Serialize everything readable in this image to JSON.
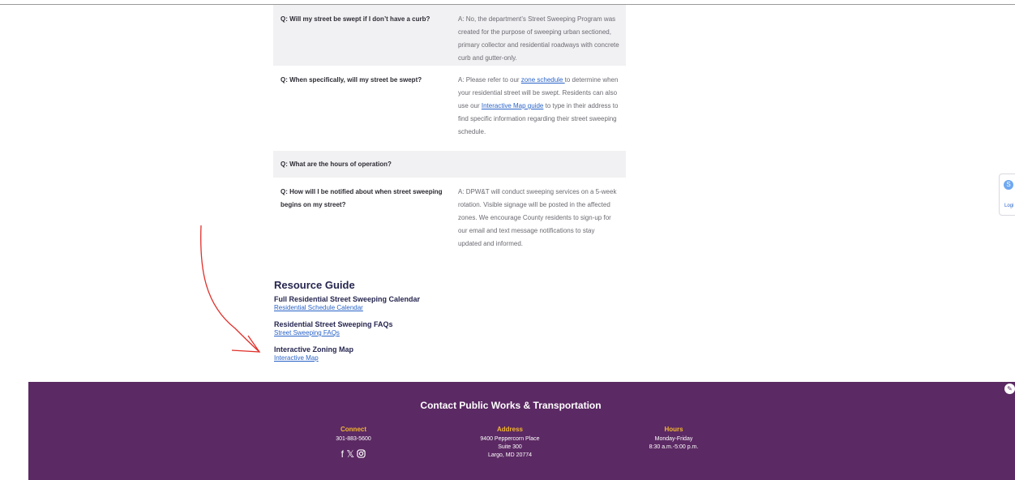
{
  "faq": [
    {
      "question": "Q: Will my street be swept if I don’t have a curb?",
      "answer": "A: No, the department’s Street Sweeping Program was created for the purpose of sweeping urban sectioned, primary collector and residential roadways with concrete curb and gutter-only."
    },
    {
      "question": "Q: When specifically, will my street be swept?",
      "answer_part1": "A: Please refer to our ",
      "answer_link1": "zone schedule ",
      "answer_part2": "to determine when your residential street will be swept. Residents can also use our ",
      "answer_link2": "Interactive Map guide",
      "answer_part3": " to type in their address to find specific information regarding their street sweeping schedule."
    },
    {
      "question": "Q: What are the hours of operation?",
      "answer": ""
    },
    {
      "question": "Q: How will I be notified about when street sweeping begins on my street?",
      "answer": "A: DPW&T will conduct sweeping services on a 5-week rotation. Visible signage will be posted in the affected zones. We encourage County residents to sign-up for our email and text message notifications to stay updated and informed."
    }
  ],
  "resources": {
    "title": "Resource Guide",
    "items": [
      {
        "title": "Full Residential Street Sweeping Calendar",
        "link": "Residential Schedule Calendar"
      },
      {
        "title": "Residential Street Sweeping FAQs",
        "link": "Street Sweeping FAQs"
      },
      {
        "title": "Interactive Zoning Map",
        "link": "Interactive Map"
      }
    ]
  },
  "footer": {
    "title": "Contact Public Works & Transportation",
    "connect": {
      "heading": "Connect",
      "phone": "301-883-5600"
    },
    "address": {
      "heading": "Address",
      "line1": "9400 Peppercorn Place",
      "line2": "Suite 300",
      "line3": "Largo, MD 20774"
    },
    "hours": {
      "heading": "Hours",
      "line1": "Monday-Friday",
      "line2": "8:30 a.m.-5:00 p.m."
    }
  },
  "side_widget": {
    "label": "Logi"
  },
  "colors": {
    "footer_bg": "#5b2963",
    "footer_heading": "#f2b632",
    "link": "#2a63c8",
    "annotation_arrow": "#e0302a"
  }
}
